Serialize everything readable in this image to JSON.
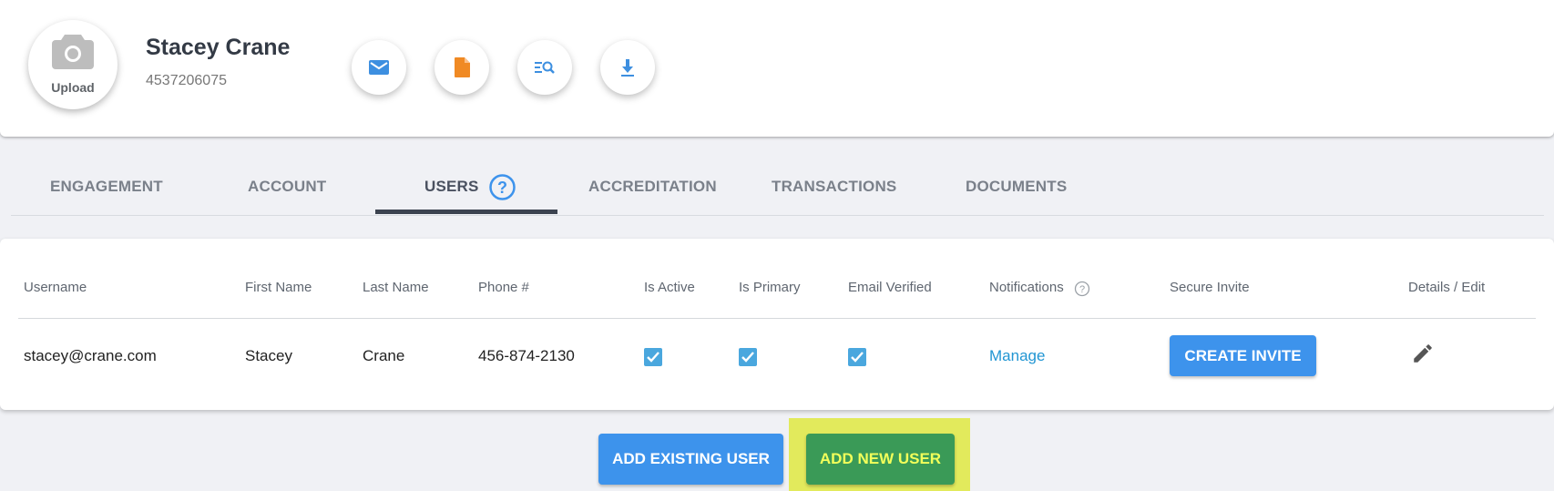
{
  "profile": {
    "upload_label": "Upload",
    "name": "Stacey Crane",
    "phone": "4537206075"
  },
  "actions": [
    {
      "icon": "mail-icon",
      "color": "#3d8fe0"
    },
    {
      "icon": "document-icon",
      "color": "#f08a24"
    },
    {
      "icon": "search-list-icon",
      "color": "#3d8fe0"
    },
    {
      "icon": "download-icon",
      "color": "#3d8fe0"
    }
  ],
  "tabs": [
    {
      "label": "ENGAGEMENT"
    },
    {
      "label": "ACCOUNT"
    },
    {
      "label": "USERS",
      "active": true
    },
    {
      "label": "ACCREDITATION"
    },
    {
      "label": "TRANSACTIONS"
    },
    {
      "label": "DOCUMENTS"
    }
  ],
  "table": {
    "headers": [
      "Username",
      "First Name",
      "Last Name",
      "Phone #",
      "Is Active",
      "Is Primary",
      "Email Verified",
      "Notifications",
      "Secure Invite",
      "Details / Edit"
    ],
    "rows": [
      {
        "username": "stacey@crane.com",
        "first_name": "Stacey",
        "last_name": "Crane",
        "phone": "456-874-2130",
        "is_active": true,
        "is_primary": true,
        "email_verified": true,
        "notifications_link": "Manage",
        "secure_invite_button": "CREATE INVITE"
      }
    ]
  },
  "buttons": {
    "add_existing": "ADD EXISTING USER",
    "add_new": "ADD NEW USER"
  },
  "colors": {
    "primary_blue": "#3d93ec",
    "green": "#3a9a57",
    "highlight_yellow": "#e2ea5c",
    "checkbox_blue": "#4aa7de",
    "link_blue": "#2296d3"
  }
}
